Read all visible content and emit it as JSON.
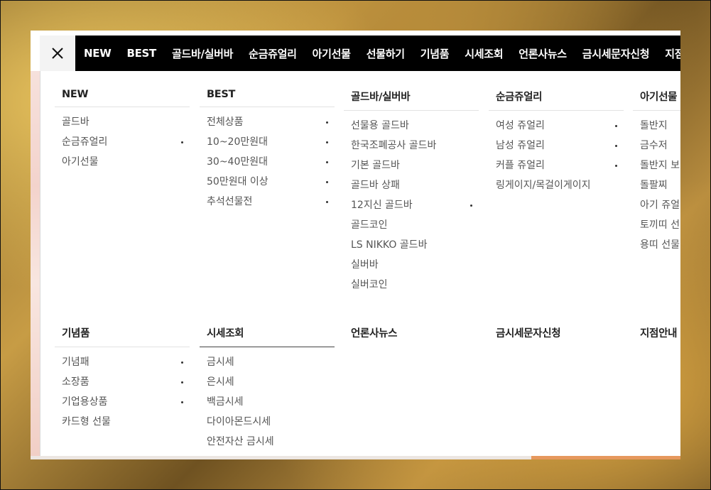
{
  "nav": {
    "close_label": "×",
    "items": [
      "NEW",
      "BEST",
      "골드바/실버바",
      "순금쥬얼리",
      "아기선물",
      "선물하기",
      "기념품",
      "시세조회",
      "언론사뉴스",
      "금시세문자신청",
      "지점안내"
    ]
  },
  "columns": [
    {
      "title": "NEW",
      "items": [
        {
          "label": "골드바",
          "sub": false
        },
        {
          "label": "순금쥬얼리",
          "sub": true
        },
        {
          "label": "아기선물",
          "sub": false
        }
      ]
    },
    {
      "title": "BEST",
      "items": [
        {
          "label": "전체상품",
          "sub": true
        },
        {
          "label": "10~20만원대",
          "sub": true
        },
        {
          "label": "30~40만원대",
          "sub": true
        },
        {
          "label": "50만원대 이상",
          "sub": true
        },
        {
          "label": "추석선물전",
          "sub": true
        }
      ]
    },
    {
      "title": "골드바/실버바",
      "items": [
        {
          "label": "선물용 골드바",
          "sub": false
        },
        {
          "label": "한국조폐공사 골드바",
          "sub": false
        },
        {
          "label": "기본 골드바",
          "sub": false
        },
        {
          "label": "골드바 상패",
          "sub": false
        },
        {
          "label": "12지신 골드바",
          "sub": true
        },
        {
          "label": "골드코인",
          "sub": false
        },
        {
          "label": "LS NIKKO 골드바",
          "sub": false
        },
        {
          "label": "실버바",
          "sub": false
        },
        {
          "label": "실버코인",
          "sub": false
        }
      ]
    },
    {
      "title": "순금쥬얼리",
      "items": [
        {
          "label": "여성 쥬얼리",
          "sub": true
        },
        {
          "label": "남성 쥬얼리",
          "sub": true
        },
        {
          "label": "커플 쥬얼리",
          "sub": true
        },
        {
          "label": "링게이지/목걸이게이지",
          "sub": false
        }
      ]
    },
    {
      "title": "아기선물",
      "items": [
        {
          "label": "돌반지",
          "sub": false
        },
        {
          "label": "금수저",
          "sub": false
        },
        {
          "label": "돌반지 보",
          "sub": false
        },
        {
          "label": "돌팔찌",
          "sub": false
        },
        {
          "label": "아기 쥬얼",
          "sub": false
        },
        {
          "label": "토끼띠 선",
          "sub": false
        },
        {
          "label": "용띠 선물",
          "sub": false
        }
      ]
    },
    {
      "title": "기념품",
      "items": [
        {
          "label": "기념패",
          "sub": true
        },
        {
          "label": "소장품",
          "sub": true
        },
        {
          "label": "기업용상품",
          "sub": true
        },
        {
          "label": "카드형 선물",
          "sub": false
        }
      ]
    },
    {
      "title": "시세조회",
      "items": [
        {
          "label": "금시세",
          "sub": false
        },
        {
          "label": "은시세",
          "sub": false
        },
        {
          "label": "백금시세",
          "sub": false
        },
        {
          "label": "다이아몬드시세",
          "sub": false
        },
        {
          "label": "안전자산 금시세",
          "sub": false
        }
      ]
    },
    {
      "title": "언론사뉴스",
      "items": []
    },
    {
      "title": "금시세문자신청",
      "items": []
    },
    {
      "title": "지점안내",
      "items": []
    }
  ]
}
